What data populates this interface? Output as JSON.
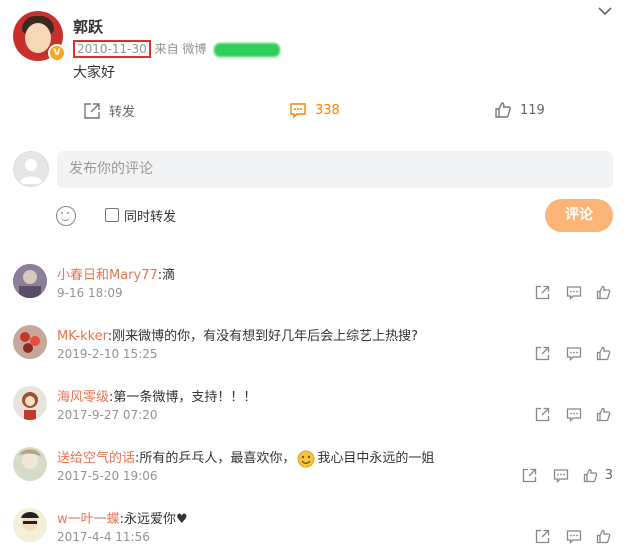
{
  "post": {
    "author": "郭跃",
    "date": "2010-11-30",
    "source": "来自 微博",
    "content": "大家好",
    "repost_label": "转发",
    "comment_count": "338",
    "like_count": "119"
  },
  "composer": {
    "placeholder": "发布你的评论",
    "also_repost": "同时转发",
    "submit": "评论"
  },
  "comments": [
    {
      "name": "小春日和Mary77",
      "text": ":滴",
      "time": "9-16 18:09",
      "likes": ""
    },
    {
      "name": "MK-kker",
      "text": ":刚来微博的你，有没有想到好几年后会上综艺上热搜?",
      "time": "2019-2-10 15:25",
      "likes": ""
    },
    {
      "name": "海风零级",
      "text": ":第一条微博，支持！！！",
      "time": "2017-9-27 07:20",
      "likes": ""
    },
    {
      "name": "送给空气的话",
      "text": ":所有的乒乓人，最喜欢你，",
      "text2": "我心目中永远的一姐",
      "time": "2017-5-20 19:06",
      "likes": "3"
    },
    {
      "name": "w一叶一蝶",
      "text": ":永远爱你♥",
      "time": "2017-4-4 11:56",
      "likes": ""
    }
  ],
  "colors": {
    "accent": "#ff8200",
    "name": "#eb7350",
    "button": "#fcb478",
    "date_box": "#d8322b"
  }
}
